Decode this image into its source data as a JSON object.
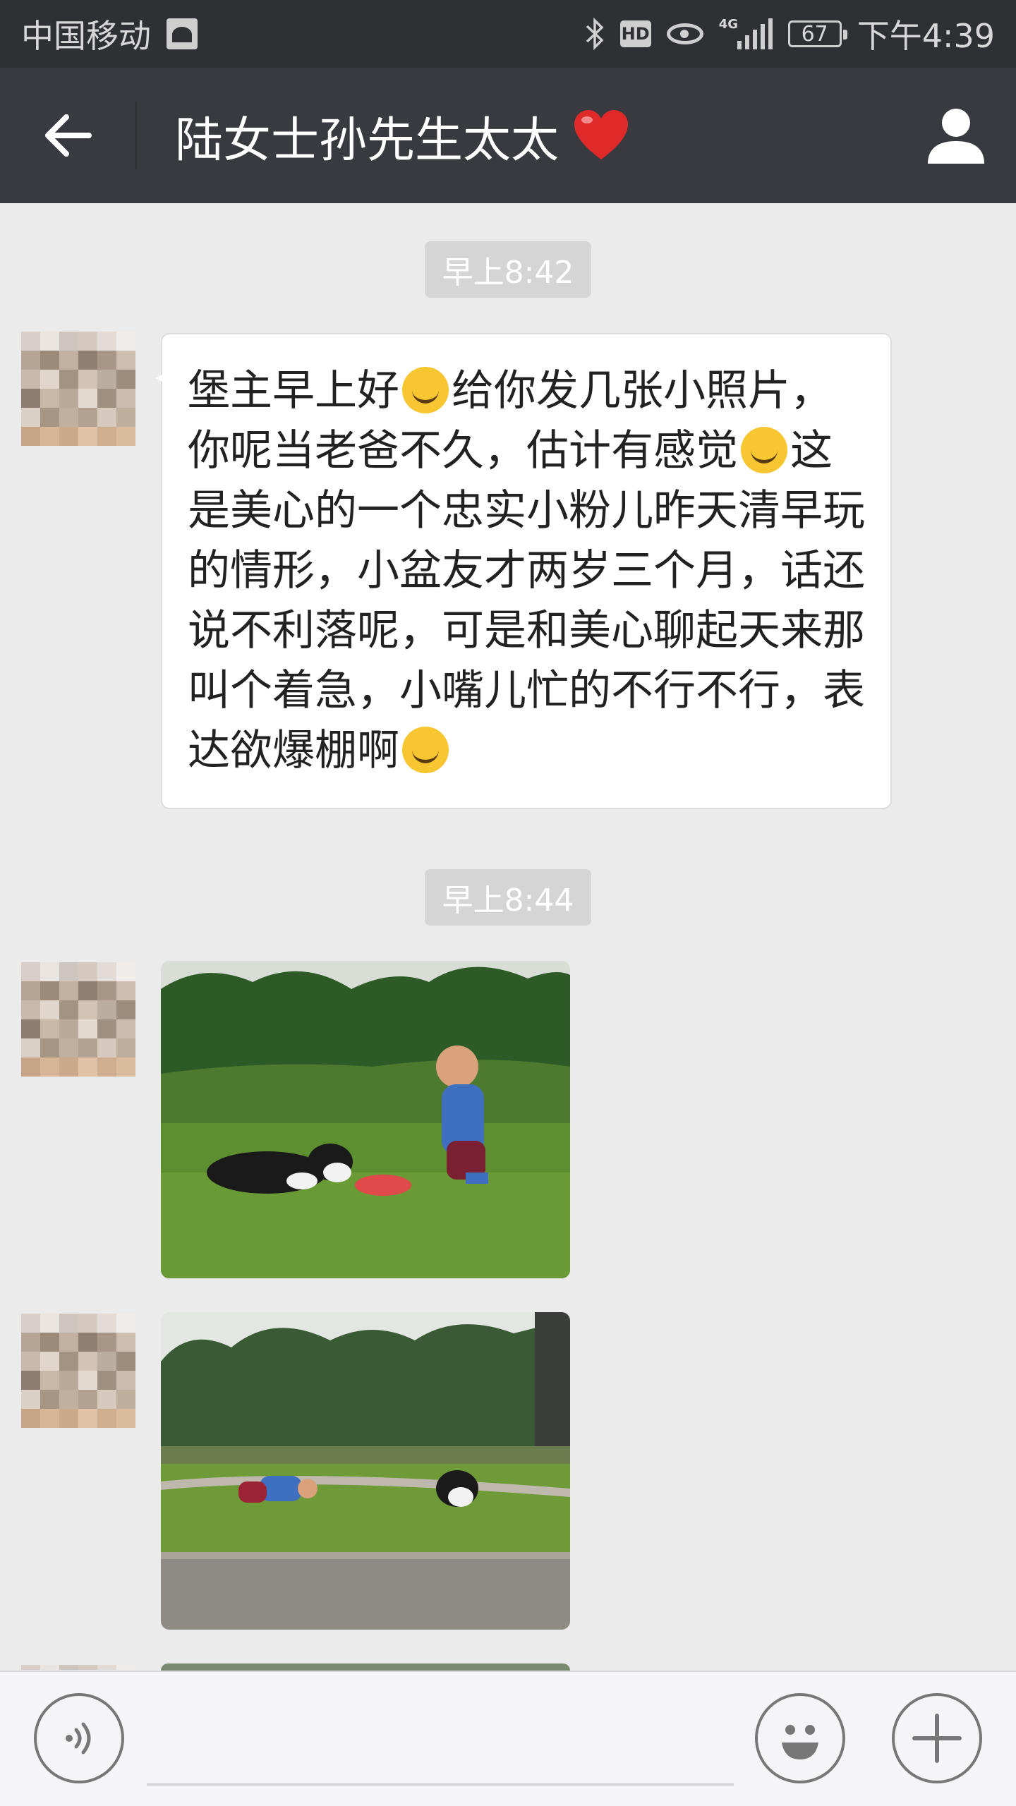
{
  "status_bar": {
    "carrier": "中国移动",
    "network": "4G",
    "battery": "67",
    "time": "下午4:39",
    "hd_label": "HD"
  },
  "title_bar": {
    "title": "陆女士孙先生太太",
    "title_emoji": "heart-icon",
    "accent_color": "#e02a2a"
  },
  "messages": [
    {
      "type": "timestamp",
      "text": "早上8:42"
    },
    {
      "type": "text",
      "sender_side": "left",
      "segments": [
        "堡主早上好",
        "[smiling-face-emoji]",
        "给你发几张小照片，你呢当老爸不久，估计有感觉",
        "[grinning-face-emoji]",
        "这是美心的一个忠实小粉儿昨天清早玩的情形，小盆友才两岁三个月，话还说不利落呢，可是和美心聊起天来那叫个着急，小嘴儿忙的不行不行，表达欲爆棚啊",
        "[rolling-laughing-emoji]"
      ],
      "text_part_1": "堡主早上好",
      "text_part_2": "给你发几张小照片，你呢当老爸不久，估计有感觉",
      "text_part_3": "这是美心的一个忠实小粉儿昨天清早玩的情形，小盆友才两岁三个月，话还说不利落呢，可是和美心聊起天来那叫个着急，小嘴儿忙的不行不行，表达欲爆棚啊"
    },
    {
      "type": "timestamp",
      "text": "早上8:44"
    },
    {
      "type": "image",
      "sender_side": "left",
      "subject": "child-and-border-collie-on-lawn-photo"
    },
    {
      "type": "image",
      "sender_side": "left",
      "subject": "child-crawling-near-dog-on-lawn-photo"
    }
  ],
  "input_bar": {
    "voice_icon": "voice-icon",
    "emoji_icon": "smiley-icon",
    "plus_icon": "plus-icon"
  }
}
